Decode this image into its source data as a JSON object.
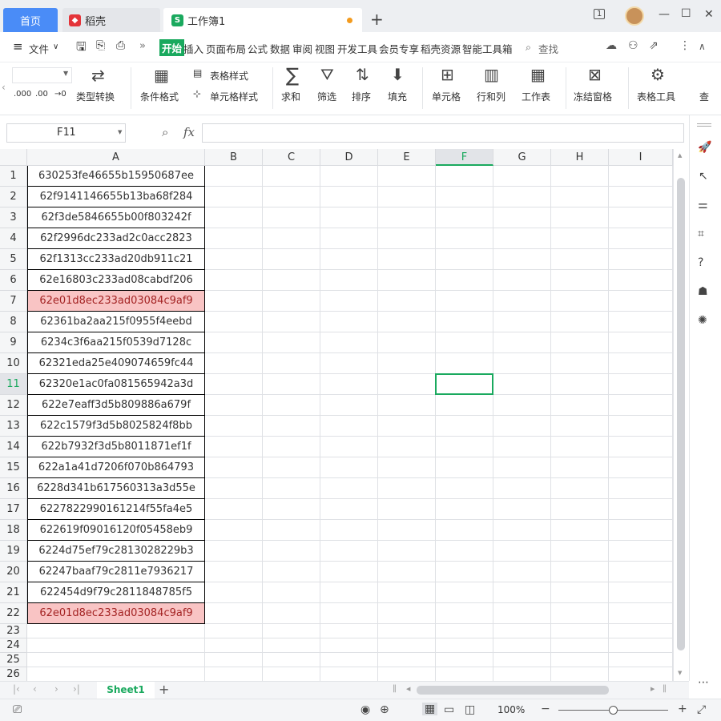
{
  "tabs": {
    "home": "首页",
    "daoke": "稻壳",
    "book": "工作簿1",
    "book_icon": "S"
  },
  "window": {
    "badge": "1",
    "minimize": "—",
    "maximize": "☐",
    "close": "✕"
  },
  "menu": {
    "file": "文件",
    "start": "开始",
    "items": [
      "插入",
      "页面布局",
      "公式",
      "数据",
      "审阅",
      "视图",
      "开发工具",
      "会员专享",
      "稻壳资源",
      "智能工具箱"
    ],
    "search": "查找"
  },
  "ribbon": {
    "type_convert": "类型转换",
    "cond_format": "条件格式",
    "table_style": "表格样式",
    "cell_style": "单元格样式",
    "sum": "求和",
    "filter": "筛选",
    "sort": "排序",
    "fill": "填充",
    "cell": "单元格",
    "rowcol": "行和列",
    "worksheet": "工作表",
    "freeze": "冻结窗格",
    "table_tools": "表格工具",
    "find_cut": "查",
    "dec_inc": ".000",
    "dec_dec": ".00"
  },
  "namebox": "F11",
  "fx": "fx",
  "columns": [
    "A",
    "B",
    "C",
    "D",
    "E",
    "F",
    "G",
    "H",
    "I"
  ],
  "active_col": "F",
  "active_row": "11",
  "rows": [
    {
      "n": "1",
      "a": "630253fe46655b15950687ee"
    },
    {
      "n": "2",
      "a": "62f9141146655b13ba68f284"
    },
    {
      "n": "3",
      "a": "62f3de5846655b00f803242f"
    },
    {
      "n": "4",
      "a": "62f2996dc233ad2c0acc2823"
    },
    {
      "n": "5",
      "a": "62f1313cc233ad20db911c21"
    },
    {
      "n": "6",
      "a": "62e16803c233ad08cabdf206"
    },
    {
      "n": "7",
      "a": "62e01d8ec233ad03084c9af9",
      "hl": true
    },
    {
      "n": "8",
      "a": "62361ba2aa215f0955f4eebd"
    },
    {
      "n": "9",
      "a": "6234c3f6aa215f0539d7128c"
    },
    {
      "n": "10",
      "a": "62321eda25e409074659fc44"
    },
    {
      "n": "11",
      "a": "62320e1ac0fa081565942a3d"
    },
    {
      "n": "12",
      "a": "622e7eaff3d5b809886a679f"
    },
    {
      "n": "13",
      "a": "622c1579f3d5b8025824f8bb"
    },
    {
      "n": "14",
      "a": "622b7932f3d5b8011871ef1f"
    },
    {
      "n": "15",
      "a": "622a1a41d7206f070b864793"
    },
    {
      "n": "16",
      "a": "6228d341b617560313a3d55e"
    },
    {
      "n": "17",
      "a": "6227822990161214f55fa4e5"
    },
    {
      "n": "18",
      "a": "622619f09016120f05458eb9"
    },
    {
      "n": "19",
      "a": "6224d75ef79c2813028229b3"
    },
    {
      "n": "20",
      "a": "62247baaf79c2811e7936217"
    },
    {
      "n": "21",
      "a": "622454d9f79c2811848785f5"
    },
    {
      "n": "22",
      "a": "62e01d8ec233ad03084c9af9",
      "hl": true
    },
    {
      "n": "23",
      "a": ""
    },
    {
      "n": "24",
      "a": ""
    },
    {
      "n": "25",
      "a": ""
    },
    {
      "n": "26",
      "a": ""
    }
  ],
  "sheet": {
    "name": "Sheet1",
    "add": "+"
  },
  "status": {
    "zoom": "100%"
  },
  "colors": {
    "accent": "#1aa95e",
    "tab_blue": "#4a8cf7",
    "highlight_bg": "#f9c4c4",
    "highlight_text": "#a42424"
  }
}
